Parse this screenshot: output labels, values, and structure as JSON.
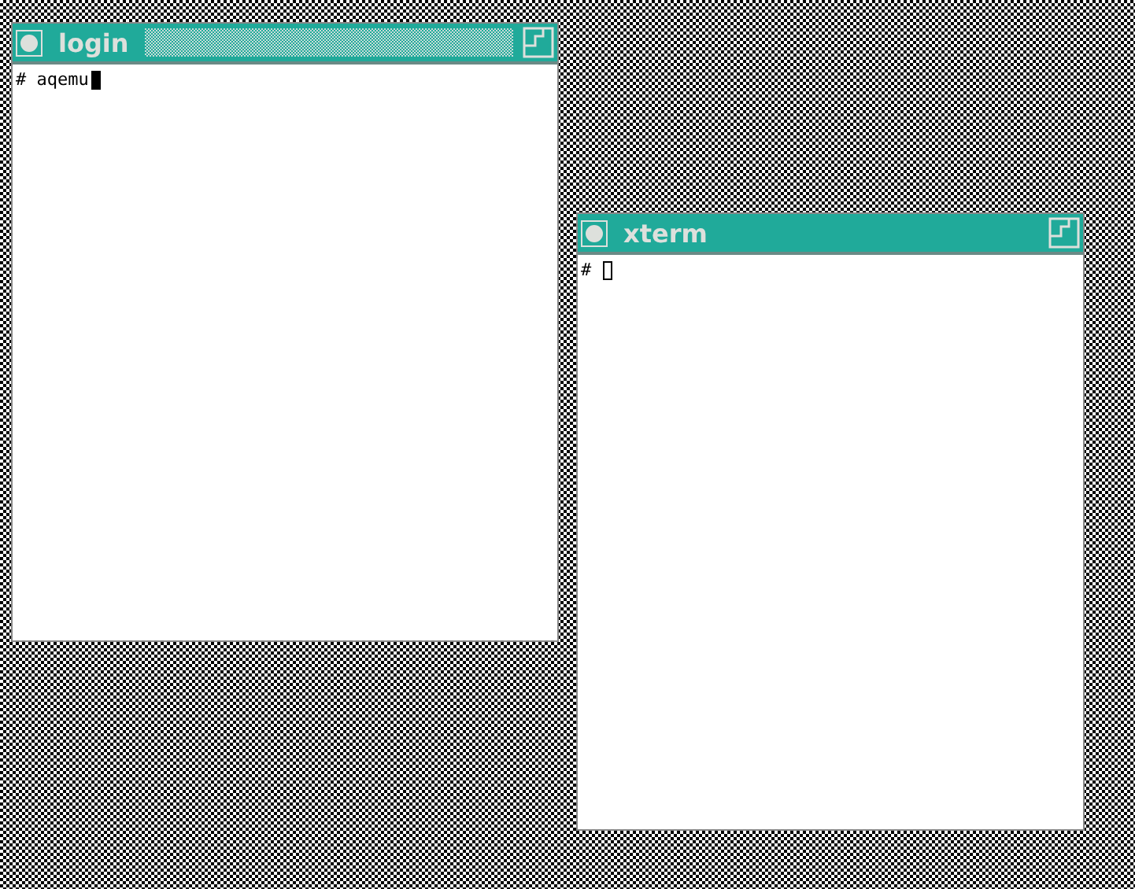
{
  "windows": [
    {
      "title": "login",
      "focused": true,
      "lines": [
        "# aqemu"
      ]
    },
    {
      "title": "xterm",
      "focused": false,
      "lines": [
        "#"
      ]
    }
  ]
}
